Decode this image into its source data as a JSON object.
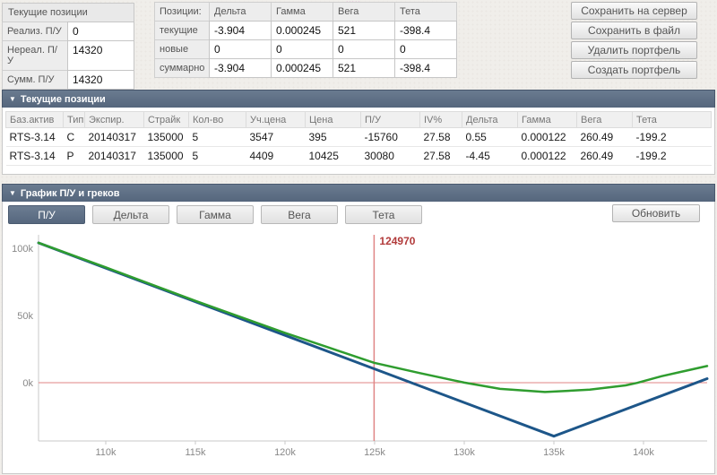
{
  "summary": {
    "title": "Текущие позиции",
    "rows": [
      {
        "label": "Реализ. П/У",
        "value": "0"
      },
      {
        "label": "Нереал. П/У",
        "value": "14320"
      },
      {
        "label": "Сумм. П/У",
        "value": "14320"
      }
    ]
  },
  "greeks": {
    "corner": "Позиции:",
    "columns": [
      "Дельта",
      "Гамма",
      "Вега",
      "Тета"
    ],
    "rows": [
      {
        "label": "текущие",
        "values": [
          "-3.904",
          "0.000245",
          "521",
          "-398.4"
        ]
      },
      {
        "label": "новые",
        "values": [
          "0",
          "0",
          "0",
          "0"
        ]
      },
      {
        "label": "суммарно",
        "values": [
          "-3.904",
          "0.000245",
          "521",
          "-398.4"
        ]
      }
    ]
  },
  "actions": [
    "Сохранить на сервер",
    "Сохранить в файл",
    "Удалить портфель",
    "Создать портфель"
  ],
  "positions_panel": {
    "collapse_icon": "▼",
    "title": "Текущие позиции",
    "columns": [
      "Баз.актив",
      "Тип",
      "Экспир.",
      "Страйк",
      "Кол-во",
      "Уч.цена",
      "Цена",
      "П/У",
      "IV%",
      "Дельта",
      "Гамма",
      "Вега",
      "Тета"
    ],
    "rows": [
      [
        "RTS-3.14",
        "C",
        "20140317",
        "135000",
        "5",
        "3547",
        "395",
        "-15760",
        "27.58",
        "0.55",
        "0.000122",
        "260.49",
        "-199.2"
      ],
      [
        "RTS-3.14",
        "P",
        "20140317",
        "135000",
        "5",
        "4409",
        "10425",
        "30080",
        "27.58",
        "-4.45",
        "0.000122",
        "260.49",
        "-199.2"
      ]
    ]
  },
  "chart_panel": {
    "collapse_icon": "▼",
    "title": "График П/У и греков",
    "tabs": [
      {
        "label": "П/У",
        "active": true
      },
      {
        "label": "Дельта",
        "active": false
      },
      {
        "label": "Гамма",
        "active": false
      },
      {
        "label": "Вега",
        "active": false
      },
      {
        "label": "Тета",
        "active": false
      }
    ],
    "refresh_label": "Обновить"
  },
  "chart_data": {
    "type": "line",
    "title": "",
    "xlabel": "",
    "ylabel": "",
    "grid": false,
    "legend": "none",
    "x_axis": {
      "min": 106250,
      "max": 143550,
      "ticks": [
        110000,
        115000,
        120000,
        125000,
        130000,
        135000,
        140000
      ],
      "tick_labels": [
        "110k",
        "115k",
        "120k",
        "125k",
        "130k",
        "135k",
        "140k"
      ]
    },
    "y_axis": {
      "min": -43333,
      "max": 110000,
      "ticks": [
        0,
        50000,
        100000
      ],
      "tick_labels": [
        "0k",
        "50k",
        "100k"
      ]
    },
    "zero_line": 0,
    "marker": {
      "x": 124970,
      "label": "124970"
    },
    "series": [
      {
        "name": "payoff-at-expiry",
        "color": "#1d5689",
        "width": 3,
        "points": [
          [
            106250,
            103970
          ],
          [
            135000,
            -39780
          ],
          [
            143550,
            2970
          ]
        ]
      },
      {
        "name": "current-pl",
        "color": "#2f9d2f",
        "width": 2.5,
        "points": [
          [
            106250,
            104100
          ],
          [
            110000,
            85800
          ],
          [
            115000,
            60900
          ],
          [
            120000,
            37100
          ],
          [
            122500,
            25900
          ],
          [
            124970,
            14800
          ],
          [
            127500,
            7200
          ],
          [
            130000,
            100
          ],
          [
            132000,
            -4600
          ],
          [
            134500,
            -6900
          ],
          [
            137000,
            -5200
          ],
          [
            139000,
            -2000
          ],
          [
            139650,
            -100
          ],
          [
            141000,
            4800
          ],
          [
            143550,
            12400
          ]
        ]
      }
    ],
    "colors": {
      "axis": "#c9c9c9",
      "tick_text": "#888888",
      "marker_line": "#e08585",
      "marker_text": "#b23b3b"
    }
  }
}
